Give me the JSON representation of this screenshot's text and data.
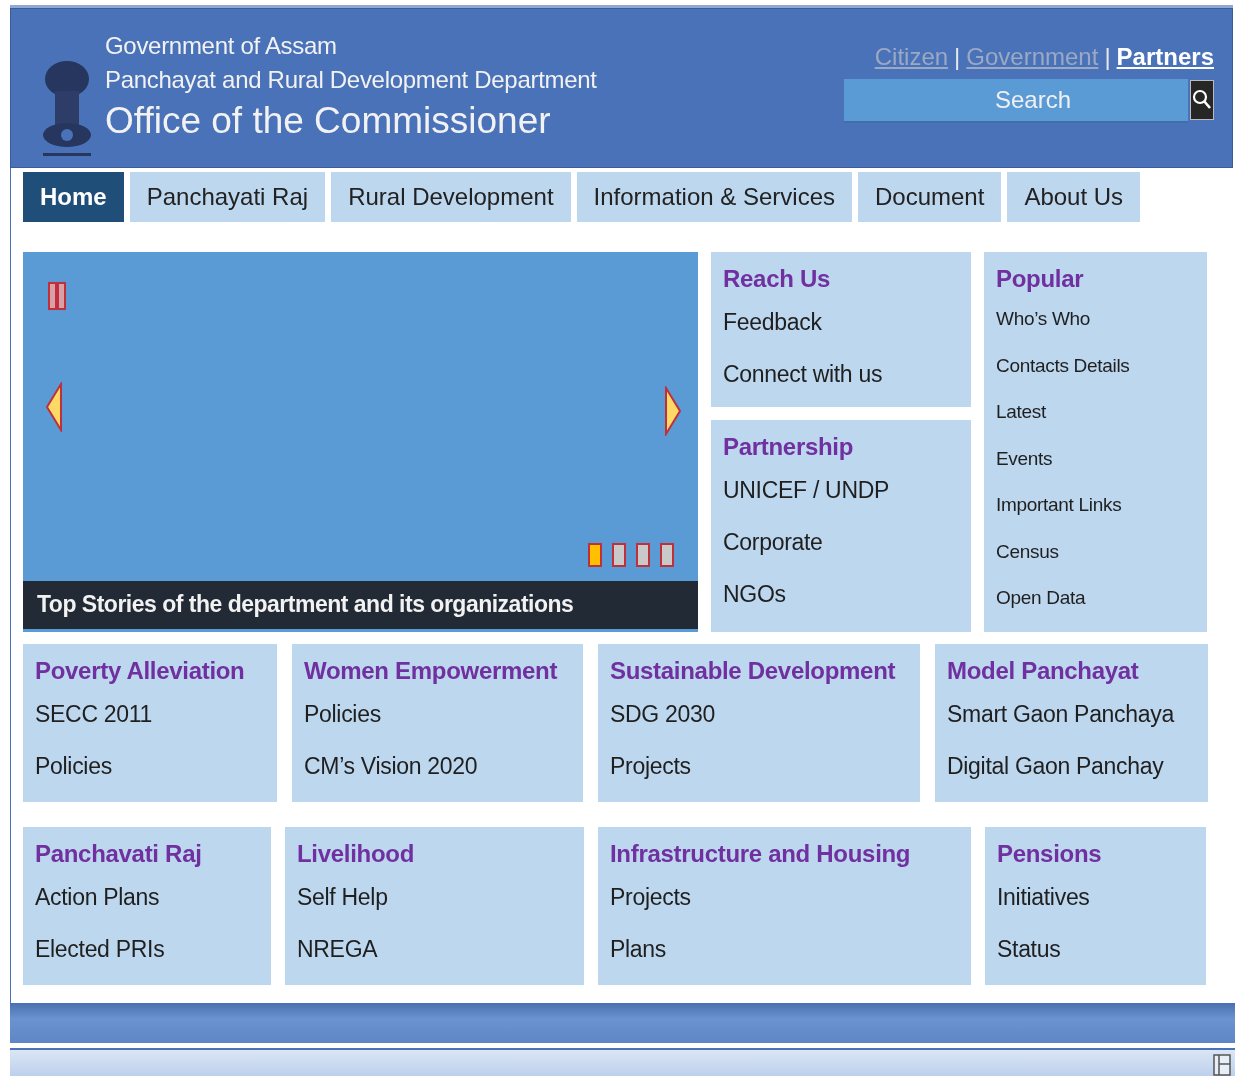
{
  "header": {
    "lines": [
      "Government of Assam",
      "Panchayat and Rural Development Department",
      "Office of the Commissioner"
    ],
    "audience_links": [
      {
        "label": "Citizen",
        "selected": false
      },
      {
        "label": "Government",
        "selected": false
      },
      {
        "label": "Partners",
        "selected": true
      }
    ],
    "separator": "|",
    "search": {
      "placeholder": "Search"
    }
  },
  "nav": [
    {
      "label": "Home",
      "selected": true
    },
    {
      "label": "Panchayati Raj",
      "selected": false
    },
    {
      "label": "Rural Development",
      "selected": false
    },
    {
      "label": "Information & Services",
      "selected": false
    },
    {
      "label": "Document",
      "selected": false
    },
    {
      "label": "About Us",
      "selected": false
    }
  ],
  "slider": {
    "caption": "Top Stories of the department and its organizations",
    "slides": [
      {
        "selected": true
      },
      {
        "selected": false
      },
      {
        "selected": false
      },
      {
        "selected": false
      }
    ]
  },
  "side_panels": [
    {
      "title": "Reach Us",
      "items": [
        "Feedback",
        "Connect with us"
      ]
    },
    {
      "title": "Partnership",
      "items": [
        "UNICEF / UNDP",
        "Corporate",
        "NGOs"
      ]
    }
  ],
  "popular": {
    "title": "Popular",
    "items": [
      "Who’s Who",
      "Contacts  Details",
      "Latest",
      "Events",
      "Important Links",
      "Census",
      "Open Data"
    ]
  },
  "section_rows": [
    [
      {
        "title": "Poverty Alleviation",
        "items": [
          "SECC 2011",
          "Policies"
        ]
      },
      {
        "title": "Women Empowerment",
        "items": [
          "Policies",
          "CM’s Vision 2020"
        ]
      },
      {
        "title": "Sustainable Development",
        "items": [
          "SDG 2030",
          "Projects"
        ]
      },
      {
        "title": "Model Panchayat",
        "items": [
          "Smart Gaon Panchaya",
          "Digital Gaon Panchay"
        ]
      }
    ],
    [
      {
        "title": "Panchavati Raj",
        "items": [
          "Action Plans",
          "Elected PRIs"
        ]
      },
      {
        "title": "Livelihood",
        "items": [
          "Self Help",
          "NREGA"
        ]
      },
      {
        "title": "Infrastructure and Housing",
        "items": [
          "Projects",
          "Plans"
        ]
      },
      {
        "title": "Pensions",
        "items": [
          "Initiatives",
          "Status"
        ]
      }
    ]
  ]
}
